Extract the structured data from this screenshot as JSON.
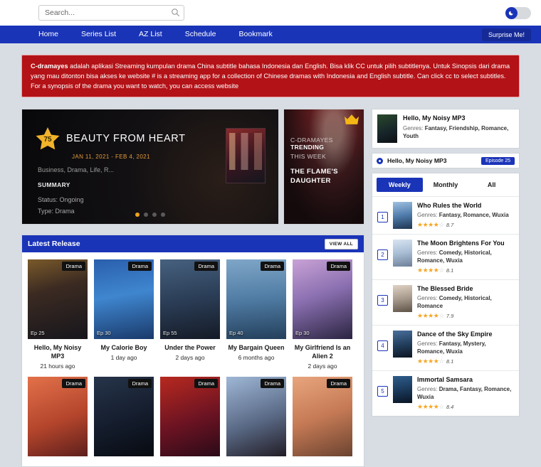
{
  "topbar": {
    "search": {
      "placeholder": "Search...",
      "value": "",
      "icon": "search-icon"
    },
    "dark_mode_icon": "moon-icon"
  },
  "nav": {
    "items": [
      {
        "label": "Home"
      },
      {
        "label": "Series List"
      },
      {
        "label": "AZ List"
      },
      {
        "label": "Schedule"
      },
      {
        "label": "Bookmark"
      }
    ],
    "surprise_label": "Surprise Me!"
  },
  "notice": {
    "brand": "C-dramayes",
    "text": " adalah aplikasi Streaming kumpulan drama China subtitle bahasa Indonesia dan English. Bisa klik CC untuk pilih subtitlenya. Untuk Sinopsis dari drama yang mau ditonton bisa akses ke website # is a streaming app for a collection of Chinese dramas with Indonesia and English subtitle. Can click cc to select subtitles. For a synopsis of the drama you want to watch, you can access website"
  },
  "hero": {
    "score": "75",
    "title": "BEAUTY FROM HEART",
    "date": "JAN 11, 2021 - FEB 4, 2021",
    "genres": "Business, Drama, Life, R...",
    "summary_label": "SUMMARY",
    "status": "Status: Ongoing",
    "type": "Type: Drama",
    "dots": 4,
    "active_dot": 0
  },
  "trending": {
    "line1_prefix": "C-DRAMAYES ",
    "line1_bold": "TRENDING",
    "line2": "THIS WEEK",
    "title": "THE FLAME'S DAUGHTER",
    "crown_icon": "crown-icon"
  },
  "latest": {
    "title": "Latest Release",
    "view_all": "VIEW ALL",
    "cards": [
      {
        "title": "Hello, My Noisy MP3",
        "time": "21 hours ago",
        "type": "Drama",
        "ep": "Ep 25",
        "art": "linear-gradient(165deg,#7a5a2a 0%,#3b2a22 38%,#16161c 100%)"
      },
      {
        "title": "My Calorie Boy",
        "time": "1 day ago",
        "type": "Drama",
        "ep": "Ep 30",
        "art": "linear-gradient(170deg,#2a5fae 0%,#3f86cf 45%,#1a3a6b 100%)"
      },
      {
        "title": "Under the Power",
        "time": "2 days ago",
        "type": "Drama",
        "ep": "Ep 55",
        "art": "linear-gradient(170deg,#46617f 0%,#2b3d56 50%,#141a26 100%)"
      },
      {
        "title": "My Bargain Queen",
        "time": "6 months ago",
        "type": "Drama",
        "ep": "Ep 40",
        "art": "linear-gradient(175deg,#7fa6c8 0%,#4f7ba3 50%,#24405c 100%)"
      },
      {
        "title": "My Girlfriend Is an Alien 2",
        "time": "2 days ago",
        "type": "Drama",
        "ep": "Ep 30",
        "art": "linear-gradient(160deg,#c9a2d6 0%,#8a6fb0 45%,#2a2440 100%)"
      },
      {
        "title": "",
        "time": "",
        "type": "Drama",
        "ep": "",
        "art": "linear-gradient(160deg,#e2714a 0%,#b4452c 55%,#5d1f1c 100%)"
      },
      {
        "title": "",
        "time": "",
        "type": "Drama",
        "ep": "",
        "art": "linear-gradient(160deg,#26344a 0%,#141c2c 55%,#070a10 100%)"
      },
      {
        "title": "",
        "time": "",
        "type": "Drama",
        "ep": "",
        "art": "linear-gradient(160deg,#b8291f 0%,#6b1322 55%,#2a0a18 100%)"
      },
      {
        "title": "",
        "time": "",
        "type": "Drama",
        "ep": "",
        "art": "linear-gradient(160deg,#9fb7d6 0%,#5a6a86 55%,#221d26 100%)"
      },
      {
        "title": "",
        "time": "",
        "type": "Drama",
        "ep": "",
        "art": "linear-gradient(160deg,#e8a57e 0%,#c57a55 50%,#6b4330 100%)"
      }
    ]
  },
  "sidebar": {
    "featured": {
      "title": "Hello, My Noisy MP3",
      "genres_label": "Genres: ",
      "genres": "Fantasy, Friendship, Romance, Youth"
    },
    "episode_row": {
      "title": "Hello, My Noisy MP3",
      "badge": "Episode 25"
    },
    "tabs": [
      {
        "label": "Weekly",
        "active": true
      },
      {
        "label": "Monthly",
        "active": false
      },
      {
        "label": "All",
        "active": false
      }
    ],
    "ranking": [
      {
        "rank": "1",
        "title": "Who Rules the World",
        "genres_label": "Genres: ",
        "genres": "Fantasy, Romance, Wuxia",
        "stars_on": 4,
        "stars_off": 1,
        "rating": "8.7",
        "art": "linear-gradient(170deg,#9fc0e0 0%,#4f7cab 50%,#1f3550 100%)"
      },
      {
        "rank": "2",
        "title": "The Moon Brightens For You",
        "genres_label": "Genres: ",
        "genres": "Comedy, Historical, Romance, Wuxia",
        "stars_on": 4,
        "stars_off": 1,
        "rating": "8.1",
        "art": "linear-gradient(170deg,#d8e4f2 0%,#a8bdd4 50%,#6d7f98 100%)"
      },
      {
        "rank": "3",
        "title": "The Blessed Bride",
        "genres_label": "Genres: ",
        "genres": "Comedy, Historical, Romance",
        "stars_on": 4,
        "stars_off": 1,
        "rating": "7.9",
        "art": "linear-gradient(170deg,#e0d3c4 0%,#a79a8d 50%,#5d5246 100%)"
      },
      {
        "rank": "4",
        "title": "Dance of the Sky Empire",
        "genres_label": "Genres: ",
        "genres": "Fantasy, Mystery, Romance, Wuxia",
        "stars_on": 4,
        "stars_off": 1,
        "rating": "8.1",
        "art": "linear-gradient(170deg,#4a6f9c 0%,#23405f 50%,#0d1622 100%)"
      },
      {
        "rank": "5",
        "title": "Immortal Samsara",
        "genres_label": "Genres: ",
        "genres": "Drama, Fantasy, Romance, Wuxia",
        "stars_on": 4,
        "stars_off": 1,
        "rating": "8.4",
        "art": "linear-gradient(170deg,#2f5d8c 0%,#1b3a5c 50%,#0a1524 100%)"
      }
    ]
  },
  "colors": {
    "brand_blue": "#1a34b8",
    "notice_red": "#b31217",
    "star_gold": "#f5a623",
    "page_bg": "#d8dde3"
  }
}
